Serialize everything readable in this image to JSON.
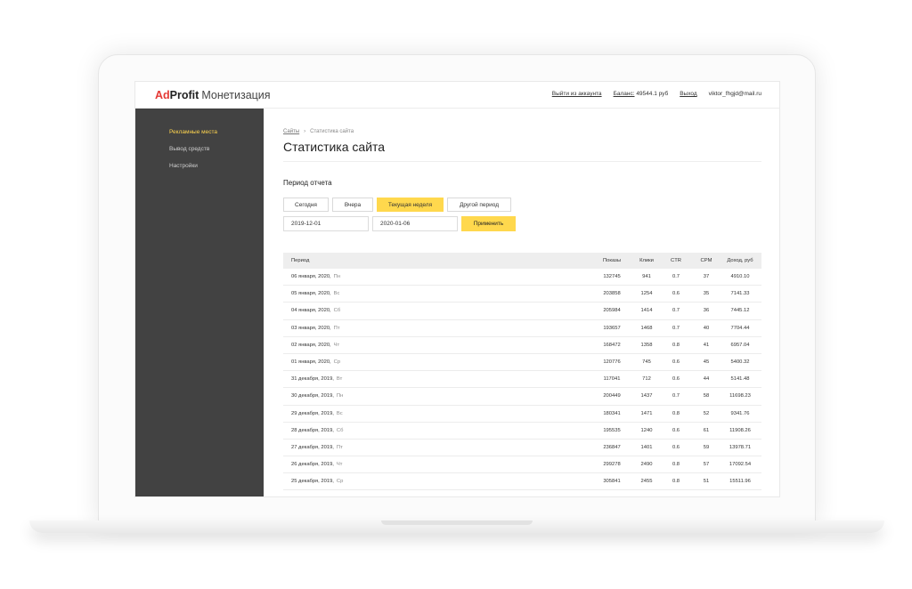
{
  "logo": {
    "ad": "Ad",
    "profit": "Profit",
    "product": "Монетизация"
  },
  "topnav": {
    "logout_account": "Выйти из аккаунта",
    "balance_label": "Баланс:",
    "balance_value": "49544.1 руб",
    "logout": "Выход",
    "email": "viktor_fhgjd@mail.ru"
  },
  "sidebar": {
    "items": [
      {
        "label": "Рекламные места",
        "active": true
      },
      {
        "label": "Вывод средств",
        "active": false
      },
      {
        "label": "Настройки",
        "active": false
      }
    ]
  },
  "breadcrumb": {
    "home": "Сайты",
    "separator": "›",
    "current": "Статистика сайта"
  },
  "page_title": "Статистика сайта",
  "period": {
    "title": "Период отчета",
    "buttons": [
      "Сегодня",
      "Вчера",
      "Текущая неделя",
      "Другой период"
    ],
    "active_button": "Текущая неделя",
    "date_from": "2019-12-01",
    "date_to": "2020-01-06",
    "apply": "Применить"
  },
  "table": {
    "headers": {
      "period": "Период",
      "impressions": "Показы",
      "clicks": "Клики",
      "ctr": "CTR",
      "cpm": "CPM",
      "revenue": "Доход, руб"
    },
    "rows": [
      {
        "date": "06 января, 2020,",
        "dow": "Пн",
        "impressions": "132745",
        "clicks": "941",
        "ctr": "0.7",
        "cpm": "37",
        "revenue": "4910.10"
      },
      {
        "date": "05 января, 2020,",
        "dow": "Вс",
        "impressions": "203858",
        "clicks": "1254",
        "ctr": "0.6",
        "cpm": "35",
        "revenue": "7141.33"
      },
      {
        "date": "04 января, 2020,",
        "dow": "Сб",
        "impressions": "205984",
        "clicks": "1414",
        "ctr": "0.7",
        "cpm": "36",
        "revenue": "7445.12"
      },
      {
        "date": "03 января, 2020,",
        "dow": "Пт",
        "impressions": "193657",
        "clicks": "1468",
        "ctr": "0.7",
        "cpm": "40",
        "revenue": "7704.44"
      },
      {
        "date": "02 января, 2020,",
        "dow": "Чт",
        "impressions": "168472",
        "clicks": "1358",
        "ctr": "0.8",
        "cpm": "41",
        "revenue": "6957.04"
      },
      {
        "date": "01 января, 2020,",
        "dow": "Ср",
        "impressions": "120776",
        "clicks": "745",
        "ctr": "0.6",
        "cpm": "45",
        "revenue": "5400.32"
      },
      {
        "date": "31 декабря, 2019,",
        "dow": "Вт",
        "impressions": "117041",
        "clicks": "712",
        "ctr": "0.6",
        "cpm": "44",
        "revenue": "5141.48"
      },
      {
        "date": "30 декабря, 2019,",
        "dow": "Пн",
        "impressions": "200449",
        "clicks": "1437",
        "ctr": "0.7",
        "cpm": "58",
        "revenue": "11698.23"
      },
      {
        "date": "29 декабря, 2019,",
        "dow": "Вс",
        "impressions": "180341",
        "clicks": "1471",
        "ctr": "0.8",
        "cpm": "52",
        "revenue": "9341.76"
      },
      {
        "date": "28 декабря, 2019,",
        "dow": "Сб",
        "impressions": "195535",
        "clicks": "1240",
        "ctr": "0.6",
        "cpm": "61",
        "revenue": "11908.26"
      },
      {
        "date": "27 декабря, 2019,",
        "dow": "Пт",
        "impressions": "236847",
        "clicks": "1401",
        "ctr": "0.6",
        "cpm": "59",
        "revenue": "13978.71"
      },
      {
        "date": "26 декабря, 2019,",
        "dow": "Чт",
        "impressions": "299278",
        "clicks": "2490",
        "ctr": "0.8",
        "cpm": "57",
        "revenue": "17092.54"
      },
      {
        "date": "25 декабря, 2019,",
        "dow": "Ср",
        "impressions": "305841",
        "clicks": "2455",
        "ctr": "0.8",
        "cpm": "51",
        "revenue": "15511.96"
      }
    ]
  },
  "colors": {
    "accent": "#ffd84d",
    "sidebar_bg": "#424242",
    "sidebar_active": "#ffd54f",
    "logo_red": "#e53935"
  }
}
